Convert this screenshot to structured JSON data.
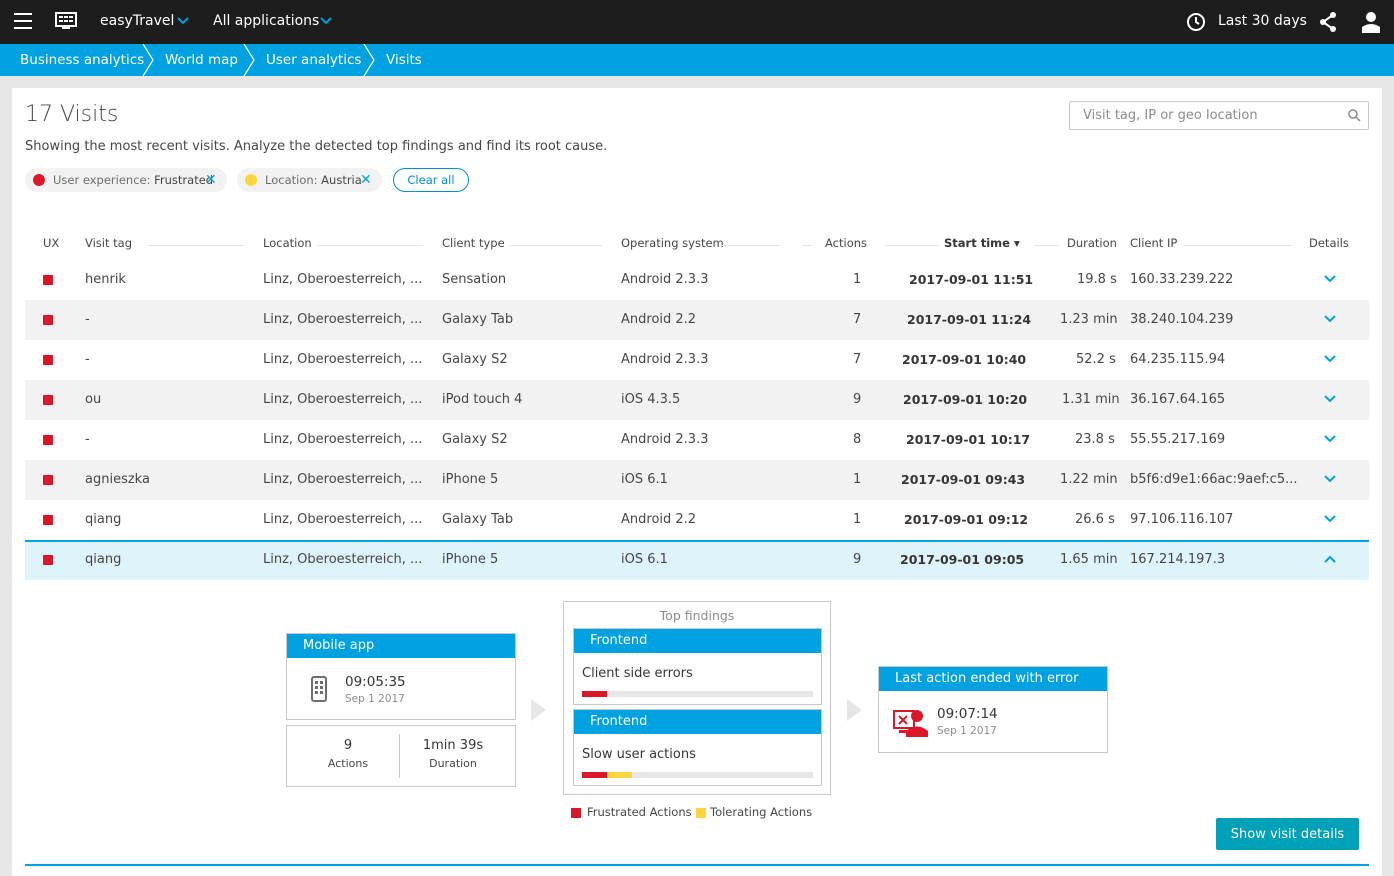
{
  "topbar": {
    "environment": "easyTravel",
    "applications": "All applications",
    "timeframe": "Last 30 days"
  },
  "breadcrumb": [
    "Business analytics",
    "World map",
    "User analytics",
    "Visits"
  ],
  "page": {
    "title": "17 Visits",
    "subtitle": "Showing the most recent visits. Analyze the detected top findings and find its root cause.",
    "search_placeholder": "Visit tag, IP or geo location"
  },
  "filters": [
    {
      "label": "User experience:",
      "value": "Frustrated",
      "color": "#dc172a"
    },
    {
      "label": "Location:",
      "value": "Austria",
      "color": "#fcd53f"
    }
  ],
  "clear_all": "Clear all",
  "columns": [
    "UX",
    "Visit tag",
    "Location",
    "Client type",
    "Operating system",
    "Actions",
    "Start time ▾",
    "Duration",
    "Client IP",
    "Details"
  ],
  "rows": [
    {
      "tag": "henrik",
      "location": "Linz, Oberoesterreich, ...",
      "client": "Sensation",
      "os": "Android 2.3.3",
      "actions": "1",
      "start": "2017-09-01 11:51",
      "duration": "19.8 s",
      "ip": "160.33.239.222"
    },
    {
      "tag": "-",
      "location": "Linz, Oberoesterreich, ...",
      "client": "Galaxy Tab",
      "os": "Android 2.2",
      "actions": "7",
      "start": "2017-09-01 11:24",
      "duration": "1.23 min",
      "ip": "38.240.104.239"
    },
    {
      "tag": "-",
      "location": "Linz, Oberoesterreich, ...",
      "client": "Galaxy S2",
      "os": "Android 2.3.3",
      "actions": "7",
      "start": "2017-09-01 10:40",
      "duration": "52.2 s",
      "ip": "64.235.115.94"
    },
    {
      "tag": "ou",
      "location": "Linz, Oberoesterreich, ...",
      "client": "iPod touch 4",
      "os": "iOS 4.3.5",
      "actions": "9",
      "start": "2017-09-01 10:20",
      "duration": "1.31 min",
      "ip": "36.167.64.165"
    },
    {
      "tag": "-",
      "location": "Linz, Oberoesterreich, ...",
      "client": "Galaxy S2",
      "os": "Android 2.3.3",
      "actions": "8",
      "start": "2017-09-01 10:17",
      "duration": "23.8 s",
      "ip": "55.55.217.169"
    },
    {
      "tag": "agnieszka",
      "location": "Linz, Oberoesterreich, ...",
      "client": "iPhone 5",
      "os": "iOS 6.1",
      "actions": "1",
      "start": "2017-09-01 09:43",
      "duration": "1.22 min",
      "ip": "b5f6:d9e1:66ac:9aef:c5..."
    },
    {
      "tag": "qiang",
      "location": "Linz, Oberoesterreich, ...",
      "client": "Galaxy Tab",
      "os": "Android 2.2",
      "actions": "1",
      "start": "2017-09-01 09:12",
      "duration": "26.6 s",
      "ip": "97.106.116.107"
    },
    {
      "tag": "qiang",
      "location": "Linz, Oberoesterreich, ...",
      "client": "iPhone 5",
      "os": "iOS 6.1",
      "actions": "9",
      "start": "2017-09-01 09:05",
      "duration": "1.65 min",
      "ip": "167.214.197.3"
    }
  ],
  "detail": {
    "app_title": "Mobile app",
    "app_time": "09:05:35",
    "app_date": "Sep 1 2017",
    "actions_value": "9",
    "actions_label": "Actions",
    "duration_value": "1min 39s",
    "duration_label": "Duration",
    "findings_title": "Top findings",
    "findings": [
      {
        "head": "Frontend",
        "label": "Client side errors",
        "frustrated": 0.11,
        "tolerating": 0
      },
      {
        "head": "Frontend",
        "label": "Slow user actions",
        "frustrated": 0.11,
        "tolerating": 0.11
      }
    ],
    "legend_frustrated": "Frustrated Actions",
    "legend_tolerating": "Tolerating Actions",
    "last_title": "Last action ended with error",
    "last_time": "09:07:14",
    "last_date": "Sep 1 2017",
    "button": "Show visit details"
  },
  "colors": {
    "accent": "#00a1e0",
    "frustrated": "#dc172a",
    "tolerating": "#fcd53f",
    "button": "#00a1b8"
  }
}
